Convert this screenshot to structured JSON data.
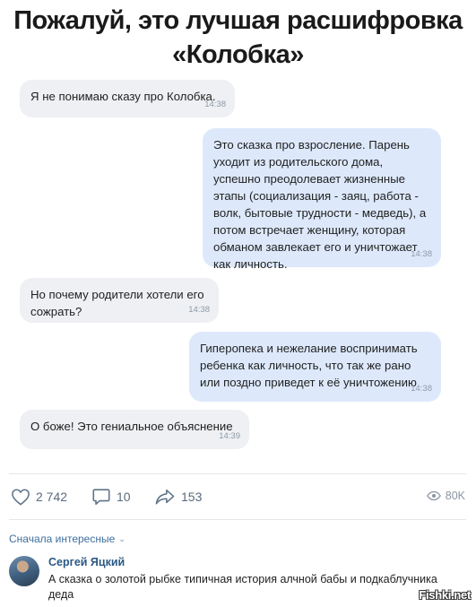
{
  "headline": {
    "line1": "Пожалуй, это лучшая расшифровка",
    "line2": "«Колобка»"
  },
  "messages": [
    {
      "side": "in",
      "text": "Я не понимаю сказу про Колобка.",
      "time": "14:38"
    },
    {
      "side": "out",
      "text": "Это сказка про взросление. Парень уходит из родительского дома, успешно преодолевает жизненные этапы (социализация - заяц, работа - волк, бытовые трудности - медведь), а потом встречает женщину, которая обманом завлекает его и уничтожает как личность.",
      "time": "14:38"
    },
    {
      "side": "in",
      "text": "Но почему родители хотели его сожрать?",
      "time": "14:38"
    },
    {
      "side": "out",
      "text": "Гиперопека и нежелание воспринимать ребенка как личность, что так же рано или поздно приведет к её уничтожению",
      "time": "14:38"
    },
    {
      "side": "in",
      "text": "О боже! Это гениальное объяснение",
      "time": "14:39"
    }
  ],
  "actions": {
    "likes": "2 742",
    "comments": "10",
    "shares": "153",
    "views": "80K"
  },
  "comments_section": {
    "sort_label": "Сначала интересные",
    "comment": {
      "author": "Сергей Яцкий",
      "text": "А сказка о золотой рыбке типичная история алчной бабы и подкаблучника деда"
    }
  },
  "watermark": "Fishki.net",
  "colors": {
    "bubble_in": "#eef0f3",
    "bubble_out": "#dde9fb",
    "link": "#2a5885",
    "icon": "#5a6b7e"
  }
}
